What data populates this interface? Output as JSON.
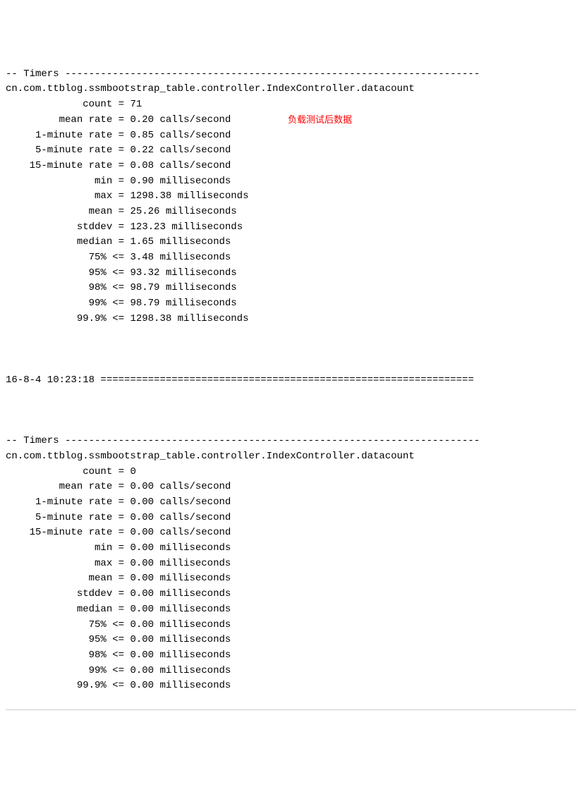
{
  "block1": {
    "header": "-- Timers ----------------------------------------------------------------------",
    "class_name": "cn.com.ttblog.ssmbootstrap_table.controller.IndexController.datacount",
    "annotation": "负载测试后数据",
    "metrics": [
      {
        "label": "             count",
        "sep": " = ",
        "value": "71",
        "unit": ""
      },
      {
        "label": "         mean rate",
        "sep": " = ",
        "value": "0.20",
        "unit": " calls/second"
      },
      {
        "label": "     1-minute rate",
        "sep": " = ",
        "value": "0.85",
        "unit": " calls/second"
      },
      {
        "label": "     5-minute rate",
        "sep": " = ",
        "value": "0.22",
        "unit": " calls/second"
      },
      {
        "label": "    15-minute rate",
        "sep": " = ",
        "value": "0.08",
        "unit": " calls/second"
      },
      {
        "label": "               min",
        "sep": " = ",
        "value": "0.90",
        "unit": " milliseconds"
      },
      {
        "label": "               max",
        "sep": " = ",
        "value": "1298.38",
        "unit": " milliseconds"
      },
      {
        "label": "              mean",
        "sep": " = ",
        "value": "25.26",
        "unit": " milliseconds"
      },
      {
        "label": "            stddev",
        "sep": " = ",
        "value": "123.23",
        "unit": " milliseconds"
      },
      {
        "label": "            median",
        "sep": " = ",
        "value": "1.65",
        "unit": " milliseconds"
      },
      {
        "label": "              75% ",
        "sep": "<= ",
        "value": "3.48",
        "unit": " milliseconds"
      },
      {
        "label": "              95% ",
        "sep": "<= ",
        "value": "93.32",
        "unit": " milliseconds"
      },
      {
        "label": "              98% ",
        "sep": "<= ",
        "value": "98.79",
        "unit": " milliseconds"
      },
      {
        "label": "              99% ",
        "sep": "<= ",
        "value": "98.79",
        "unit": " milliseconds"
      },
      {
        "label": "            99.9% ",
        "sep": "<= ",
        "value": "1298.38",
        "unit": " milliseconds"
      }
    ]
  },
  "separator": {
    "timestamp": "16-8-4 10:23:18",
    "line": " ==============================================================="
  },
  "block2": {
    "header": "-- Timers ----------------------------------------------------------------------",
    "class_name": "cn.com.ttblog.ssmbootstrap_table.controller.IndexController.datacount",
    "metrics": [
      {
        "label": "             count",
        "sep": " = ",
        "value": "0",
        "unit": ""
      },
      {
        "label": "         mean rate",
        "sep": " = ",
        "value": "0.00",
        "unit": " calls/second"
      },
      {
        "label": "     1-minute rate",
        "sep": " = ",
        "value": "0.00",
        "unit": " calls/second"
      },
      {
        "label": "     5-minute rate",
        "sep": " = ",
        "value": "0.00",
        "unit": " calls/second"
      },
      {
        "label": "    15-minute rate",
        "sep": " = ",
        "value": "0.00",
        "unit": " calls/second"
      },
      {
        "label": "               min",
        "sep": " = ",
        "value": "0.00",
        "unit": " milliseconds"
      },
      {
        "label": "               max",
        "sep": " = ",
        "value": "0.00",
        "unit": " milliseconds"
      },
      {
        "label": "              mean",
        "sep": " = ",
        "value": "0.00",
        "unit": " milliseconds"
      },
      {
        "label": "            stddev",
        "sep": " = ",
        "value": "0.00",
        "unit": " milliseconds"
      },
      {
        "label": "            median",
        "sep": " = ",
        "value": "0.00",
        "unit": " milliseconds"
      },
      {
        "label": "              75% ",
        "sep": "<= ",
        "value": "0.00",
        "unit": " milliseconds"
      },
      {
        "label": "              95% ",
        "sep": "<= ",
        "value": "0.00",
        "unit": " milliseconds"
      },
      {
        "label": "              98% ",
        "sep": "<= ",
        "value": "0.00",
        "unit": " milliseconds"
      },
      {
        "label": "              99% ",
        "sep": "<= ",
        "value": "0.00",
        "unit": " milliseconds"
      },
      {
        "label": "            99.9% ",
        "sep": "<= ",
        "value": "0.00",
        "unit": " milliseconds"
      }
    ]
  }
}
